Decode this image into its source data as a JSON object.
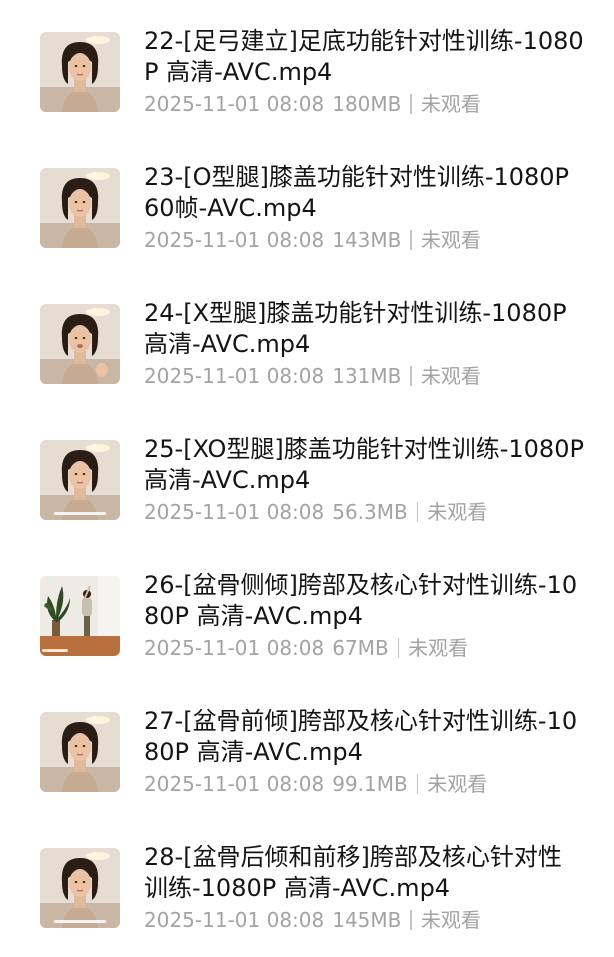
{
  "files": [
    {
      "name": "22-[足弓建立]足底功能针对性训练-1080P 高清-AVC.mp4",
      "date": "2025-11-01 08:08",
      "size": "180MB",
      "status": "未观看",
      "thumbnail": "person-portrait"
    },
    {
      "name": "23-[O型腿]膝盖功能针对性训练-1080P 60帧-AVC.mp4",
      "date": "2025-11-01 08:08",
      "size": "143MB",
      "status": "未观看",
      "thumbnail": "person-portrait"
    },
    {
      "name": "24-[X型腿]膝盖功能针对性训练-1080P 高清-AVC.mp4",
      "date": "2025-11-01 08:08",
      "size": "131MB",
      "status": "未观看",
      "thumbnail": "person-portrait"
    },
    {
      "name": "25-[XO型腿]膝盖功能针对性训练-1080P 高清-AVC.mp4",
      "date": "2025-11-01 08:08",
      "size": "56.3MB",
      "status": "未观看",
      "thumbnail": "person-portrait"
    },
    {
      "name": "26-[盆骨侧倾]胯部及核心针对性训练-1080P 高清-AVC.mp4",
      "date": "2025-11-01 08:08",
      "size": "67MB",
      "status": "未观看",
      "thumbnail": "room-with-plant"
    },
    {
      "name": "27-[盆骨前倾]胯部及核心针对性训练-1080P 高清-AVC.mp4",
      "date": "2025-11-01 08:08",
      "size": "99.1MB",
      "status": "未观看",
      "thumbnail": "person-portrait"
    },
    {
      "name": "28-[盆骨后倾和前移]胯部及核心针对性训练-1080P 高清-AVC.mp4",
      "date": "2025-11-01 08:08",
      "size": "145MB",
      "status": "未观看",
      "thumbnail": "person-portrait"
    }
  ]
}
